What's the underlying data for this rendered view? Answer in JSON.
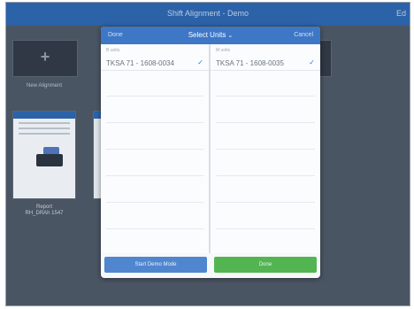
{
  "topbar": {
    "title": "Shift Alignment - Demo",
    "right_label": "Ed"
  },
  "workspace": {
    "new_tile_label": "New Alignment",
    "report_label_line1": "Report",
    "report_label_line2": "RH_DRAh 1547"
  },
  "modal": {
    "left_action": "Done",
    "title": "Select Units",
    "right_action": "Cancel",
    "left_column": {
      "header": "B units",
      "unit": "TKSA 71 - 1608-0034"
    },
    "right_column": {
      "header": "M units",
      "unit": "TKSA 71 - 1608-0035"
    },
    "check_glyph": "✓",
    "demo_button": "Start Demo Mode",
    "done_button": "Done"
  },
  "colors": {
    "topbar": "#2b62a8",
    "modal_header": "#3d77c6",
    "demo_button": "#4f86cf",
    "done_button": "#52b552"
  }
}
